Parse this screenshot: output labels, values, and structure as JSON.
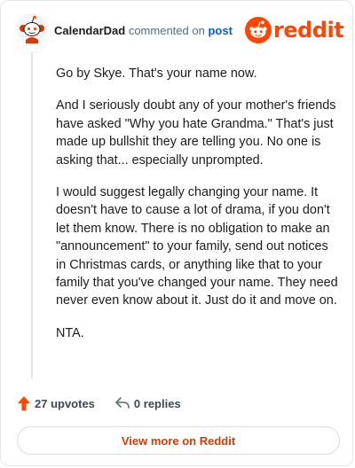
{
  "header": {
    "username": "CalendarDad",
    "action_text": "commented on",
    "post_link_text": "post",
    "logo_text": "reddit"
  },
  "comment": {
    "paragraphs": [
      "Go by Skye. That's your name now.",
      "And I seriously doubt any of your mother's friends have asked \"Why you hate Grandma.\" That's just made up bullshit they are telling you. No one is asking that... especially unprompted.",
      "I would suggest legally changing your name. It doesn't have to cause a lot of drama, if you don't let them know. There is no obligation to make an \"announcement\" to your family, send out notices in Christmas cards, or anything like that to your family that you've changed your name. They need never even know about it. Just do it and move on.",
      "NTA."
    ]
  },
  "footer": {
    "upvotes": "27 upvotes",
    "replies": "0 replies"
  },
  "view_more_label": "View more on Reddit",
  "colors": {
    "brand": "#ff4500",
    "link": "#0a5ad9",
    "view_more_text": "#d93a00",
    "muted": "#576f76"
  },
  "icons": {
    "avatar": "snoo-avatar-icon",
    "logo": "reddit-snoo-icon",
    "upvote": "upvote-arrow-icon",
    "reply": "reply-arrow-icon"
  }
}
